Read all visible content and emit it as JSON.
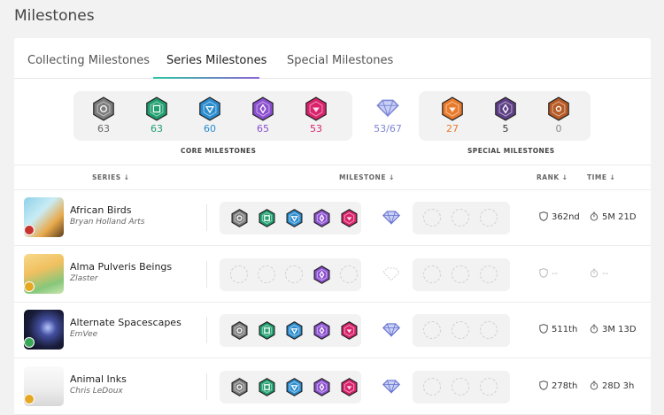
{
  "page": {
    "title": "Milestones"
  },
  "tabs": [
    {
      "label": "Collecting Milestones",
      "active": false
    },
    {
      "label": "Series Milestones",
      "active": true
    },
    {
      "label": "Special Milestones",
      "active": false
    }
  ],
  "summary": {
    "core": [
      {
        "name": "grey-hexagon-icon",
        "count": "63",
        "color": "#7c7c7c"
      },
      {
        "name": "green-hexagon-icon",
        "count": "63",
        "color": "#1f9e6e"
      },
      {
        "name": "blue-hexagon-icon",
        "count": "60",
        "color": "#2a8ccf"
      },
      {
        "name": "purple-hexagon-icon",
        "count": "65",
        "color": "#8b4fcf"
      },
      {
        "name": "magenta-hexagon-icon",
        "count": "53",
        "color": "#d8226b"
      }
    ],
    "diamond": {
      "count": "53/67",
      "color": "#7d87d6"
    },
    "special": [
      {
        "name": "orange-hexagon-icon",
        "count": "27",
        "color": "#e87a2c"
      },
      {
        "name": "dark-purple-hexagon-icon",
        "count": "5",
        "color": "#5e3e86"
      },
      {
        "name": "bronze-hexagon-icon",
        "count": "0",
        "color": "#b75a26"
      }
    ],
    "core_label": "CORE MILESTONES",
    "special_label": "SPECIAL MILESTONES"
  },
  "columns": {
    "series": "SERIES",
    "milestone": "MILESTONE",
    "rank": "RANK",
    "time": "TIME"
  },
  "rows": [
    {
      "title": "African Birds",
      "artist": "Bryan Holland Arts",
      "core": [
        true,
        true,
        true,
        true,
        true
      ],
      "diamond": true,
      "rank": "362nd",
      "time": "5M 21D",
      "badge": "#c8332d"
    },
    {
      "title": "Alma Pulveris Beings",
      "artist": "Zlaster",
      "core": [
        false,
        false,
        false,
        true,
        false
      ],
      "diamond": false,
      "rank": "--",
      "time": "--",
      "badge": "#e5a823"
    },
    {
      "title": "Alternate Spacescapes",
      "artist": "EmVee",
      "core": [
        true,
        true,
        true,
        true,
        true
      ],
      "diamond": true,
      "rank": "511th",
      "time": "3M 13D",
      "badge": "#3aa756"
    },
    {
      "title": "Animal Inks",
      "artist": "Chris LeDoux",
      "core": [
        true,
        true,
        true,
        true,
        true
      ],
      "diamond": true,
      "rank": "278th",
      "time": "28D 3h",
      "badge": "#e5a823"
    }
  ]
}
